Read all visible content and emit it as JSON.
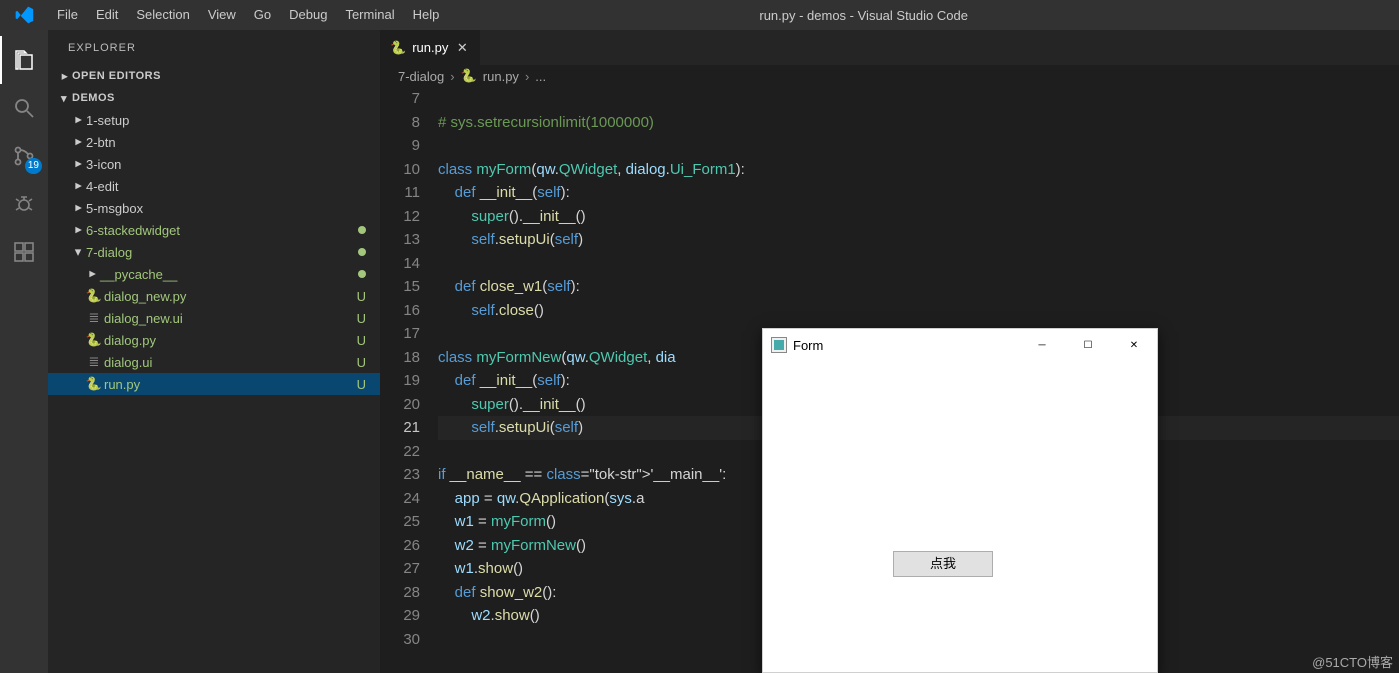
{
  "window_title": "run.py - demos - Visual Studio Code",
  "menu": [
    "File",
    "Edit",
    "Selection",
    "View",
    "Go",
    "Debug",
    "Terminal",
    "Help"
  ],
  "activitybar": {
    "scm_badge": "19"
  },
  "sidebar": {
    "title": "EXPLORER",
    "open_editors": "OPEN EDITORS",
    "root": "DEMOS",
    "folders": [
      {
        "name": "1-setup",
        "expanded": false
      },
      {
        "name": "2-btn",
        "expanded": false
      },
      {
        "name": "3-icon",
        "expanded": false
      },
      {
        "name": "4-edit",
        "expanded": false
      },
      {
        "name": "5-msgbox",
        "expanded": false
      },
      {
        "name": "6-stackedwidget",
        "expanded": false,
        "modified": true
      },
      {
        "name": "7-dialog",
        "expanded": true,
        "modified": true
      }
    ],
    "dialog_children": [
      {
        "name": "__pycache__",
        "type": "folder",
        "modified": true
      },
      {
        "name": "dialog_new.py",
        "type": "py",
        "status": "U"
      },
      {
        "name": "dialog_new.ui",
        "type": "ui",
        "status": "U"
      },
      {
        "name": "dialog.py",
        "type": "py",
        "status": "U"
      },
      {
        "name": "dialog.ui",
        "type": "ui",
        "status": "U"
      },
      {
        "name": "run.py",
        "type": "py",
        "status": "U",
        "selected": true
      }
    ]
  },
  "tab": {
    "label": "run.py"
  },
  "breadcrumbs": {
    "folder": "7-dialog",
    "file": "run.py",
    "more": "..."
  },
  "code": {
    "first_line": 7,
    "current_line": 21,
    "lines": [
      "",
      "# sys.setrecursionlimit(1000000)",
      "",
      "class myForm(qw.QWidget, dialog.Ui_Form1):",
      "    def __init__(self):",
      "        super().__init__()",
      "        self.setupUi(self)",
      "",
      "    def close_w1(self):",
      "        self.close()",
      "",
      "class myFormNew(qw.QWidget, dia",
      "    def __init__(self):",
      "        super().__init__()",
      "        self.setupUi(self)",
      "",
      "if __name__ == '__main__':",
      "    app = qw.QApplication(sys.a",
      "    w1 = myForm()",
      "    w2 = myFormNew()",
      "    w1.show()",
      "    def show_w2():",
      "        w2.show()",
      ""
    ]
  },
  "form": {
    "title": "Form",
    "button": "点我"
  },
  "watermark": "@51CTO博客"
}
